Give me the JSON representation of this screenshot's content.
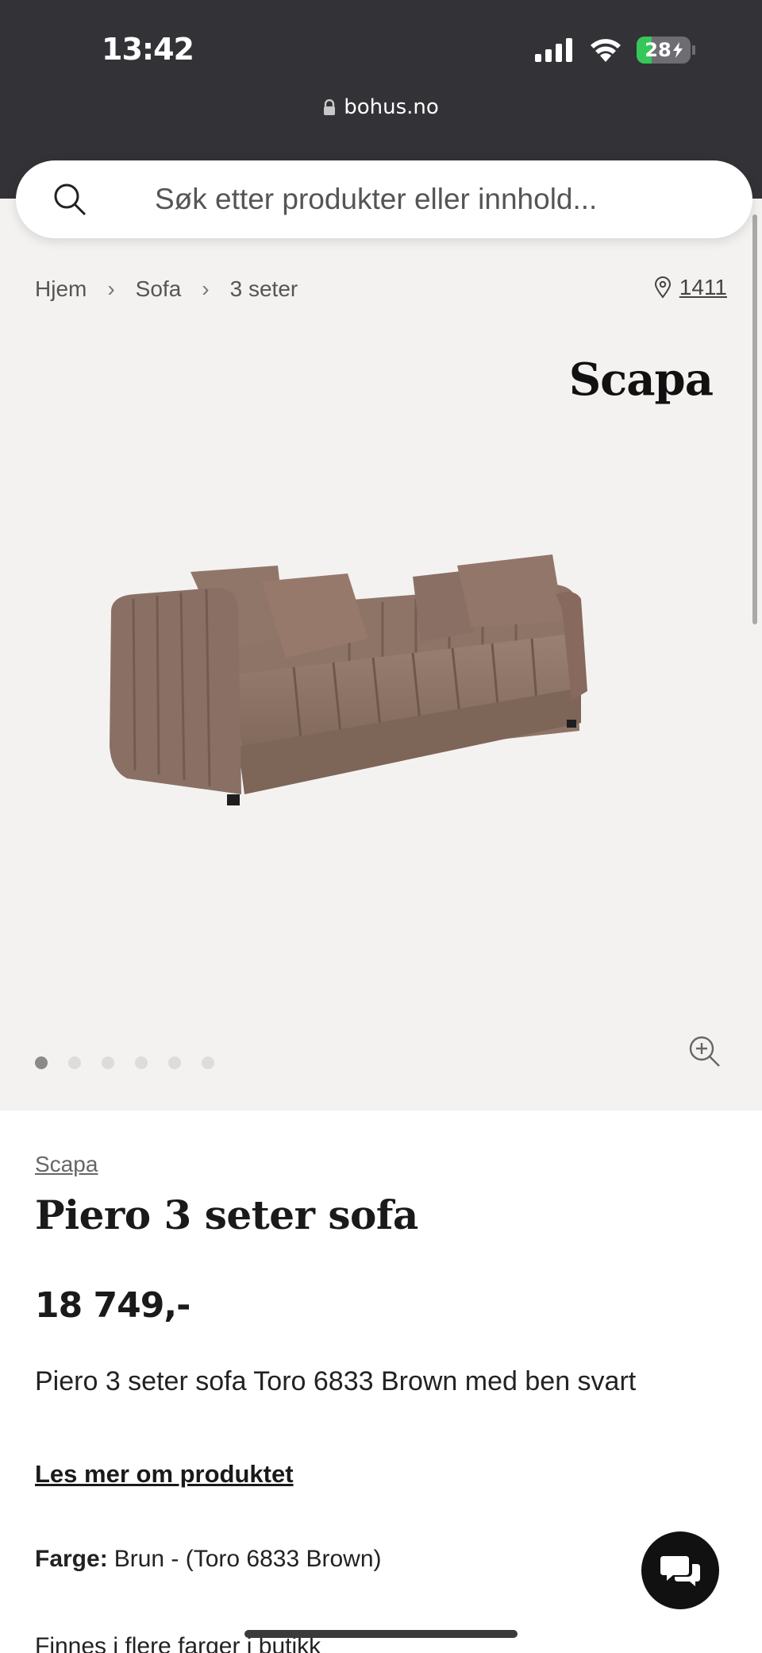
{
  "status_bar": {
    "time": "13:42",
    "battery": "28"
  },
  "browser": {
    "url": "bohus.no"
  },
  "search": {
    "placeholder": "Søk etter produkter eller innhold..."
  },
  "breadcrumb": {
    "items": [
      "Hjem",
      "Sofa",
      "3 seter"
    ],
    "store": "1411"
  },
  "gallery": {
    "brand_logo": "Scapa",
    "image_count": 6,
    "active_index": 0
  },
  "product": {
    "brand": "Scapa",
    "title": "Piero 3 seter sofa",
    "price": "18 749,-",
    "description": "Piero 3 seter sofa Toro 6833 Brown med ben svart",
    "read_more": "Les mer om produktet",
    "color_label": "Farge:",
    "color_value": "Brun - (Toro 6833 Brown)",
    "more_colors": "Finnes i flere farger i butikk"
  },
  "icons": {
    "search": "search-icon",
    "location": "location-pin-icon",
    "zoom": "zoom-in-icon",
    "chat": "chat-icon",
    "lock": "lock-icon"
  },
  "colors": {
    "top_bar": "#333337",
    "gallery_bg": "#f4f2f1",
    "sofa": "#8c7367",
    "battery_fill": "#35c759"
  }
}
